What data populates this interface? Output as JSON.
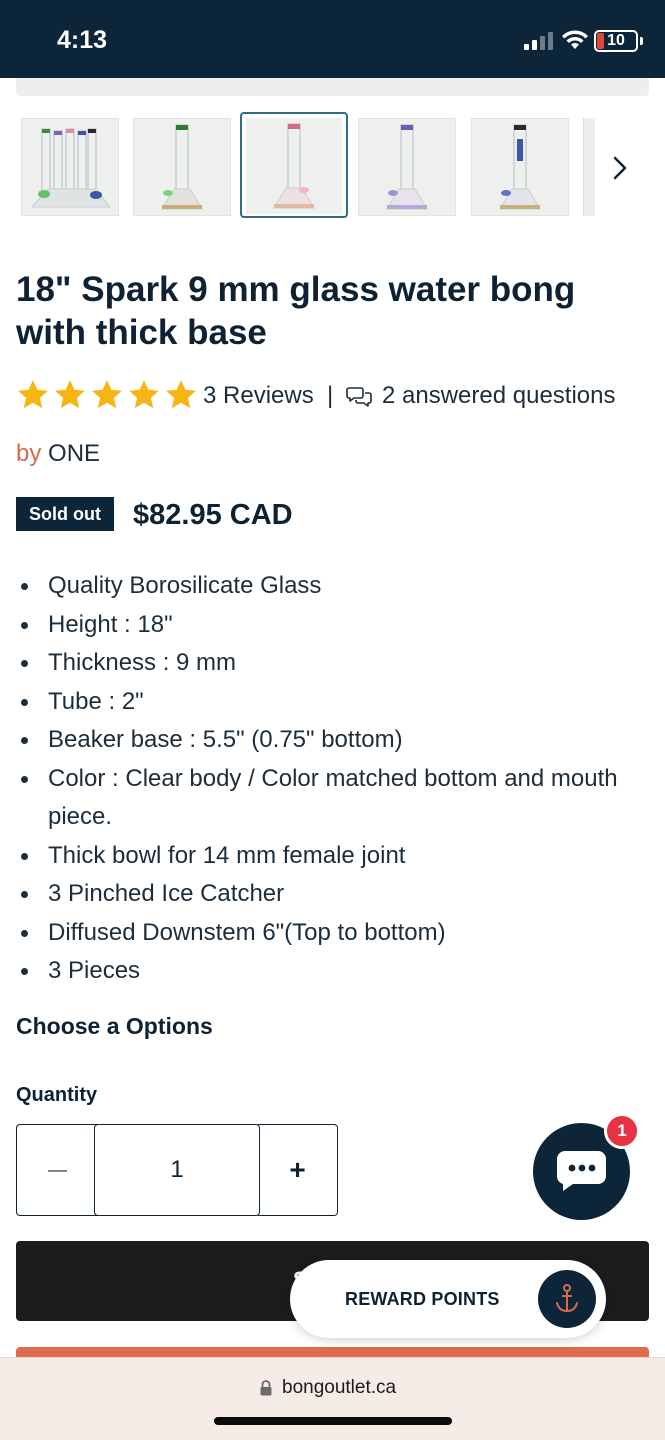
{
  "status_bar": {
    "time": "4:13",
    "battery": "10"
  },
  "gallery": {
    "thumbnail_count": 5,
    "active_index": 2,
    "next_icon": "chevron-right-icon"
  },
  "product": {
    "title": "18\" Spark 9 mm glass water bong with thick base",
    "rating": 5,
    "reviews": "3 Reviews",
    "separator": "|",
    "questions": "2 answered questions",
    "vendor_prefix": "by",
    "vendor": "ONE",
    "badge": "Sold out",
    "price": "$82.95 CAD",
    "features": [
      "Quality Borosilicate Glass",
      "Height : 18\"",
      "Thickness : 9 mm",
      "Tube : 2\"",
      "Beaker base : 5.5\" (0.75\" bottom)",
      "Color : Clear body / Color matched  bottom and mouth piece.",
      "Thick bowl for 14 mm female joint",
      "3 Pinched Ice Catcher",
      "Diffused Downstem  6\"(Top to bottom)",
      "3 Pieces"
    ]
  },
  "options": {
    "heading": "Choose a Options",
    "quantity_label": "Quantity",
    "quantity_value": "1",
    "plus_label": "+"
  },
  "add_to_cart": {
    "visible_label": "S"
  },
  "chat": {
    "badge_count": "1"
  },
  "reward": {
    "label": "REWARD POINTS"
  },
  "browser": {
    "url": "bongoutlet.ca"
  },
  "colors": {
    "navy": "#0d2538",
    "accent_orange": "#d86a4c",
    "star": "#f7b512",
    "badge_red": "#e53343"
  }
}
